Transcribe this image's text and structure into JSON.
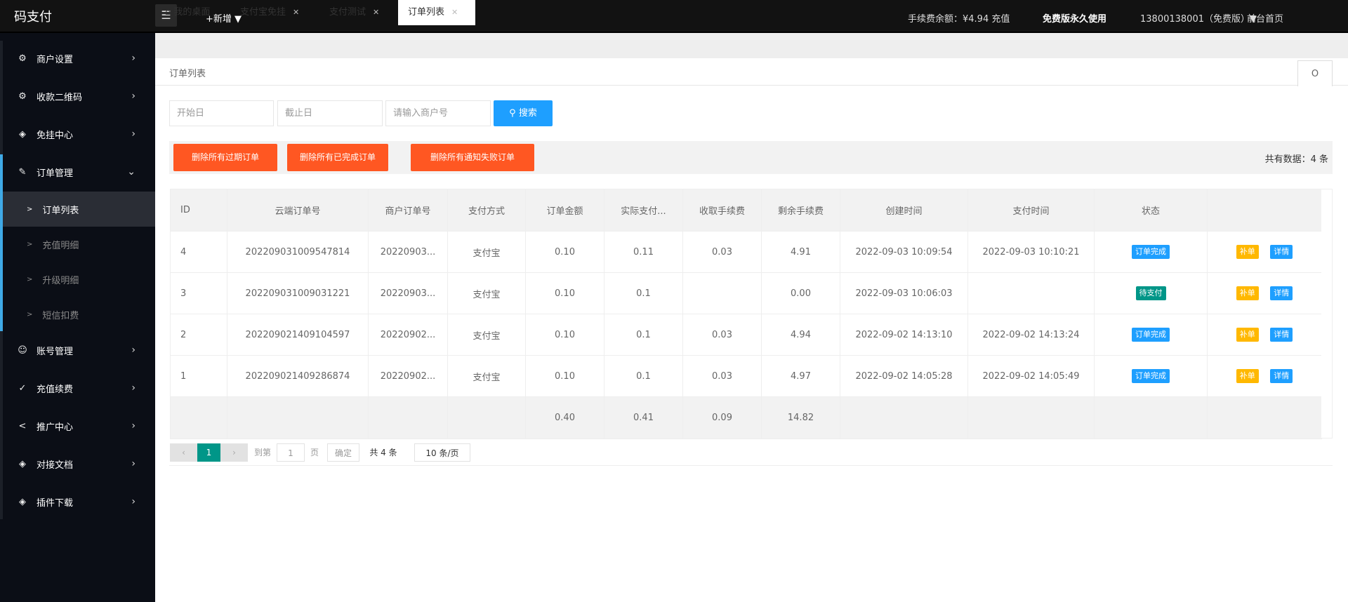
{
  "header": {
    "logo": "码支付",
    "menu_icon": "☰",
    "add_new": "+新增 ▼",
    "balance": "手续费余额：¥4.94 充值",
    "plan": "免费版永久使用",
    "account": "13800138001（免费版）▼",
    "frontpage": "前台首页"
  },
  "sidebar": {
    "items": [
      {
        "label": "商户设置",
        "icon": "⚙",
        "arrow": "›"
      },
      {
        "label": "收款二维码",
        "icon": "⚙",
        "arrow": "›"
      },
      {
        "label": "免挂中心",
        "icon": "◈",
        "arrow": "›"
      },
      {
        "label": "订单管理",
        "icon": "✎",
        "arrow": "⌄"
      },
      {
        "label": "账号管理",
        "icon": "☺",
        "arrow": "›"
      },
      {
        "label": "充值续费",
        "icon": "✓",
        "arrow": "›"
      },
      {
        "label": "推广中心",
        "icon": "<",
        "arrow": "›"
      },
      {
        "label": "对接文档",
        "icon": "◈",
        "arrow": "›"
      },
      {
        "label": "插件下载",
        "icon": "◈",
        "arrow": "›"
      }
    ],
    "sub_items": [
      {
        "label": "订单列表"
      },
      {
        "label": "充值明细"
      },
      {
        "label": "升级明细"
      },
      {
        "label": "短信扣费"
      }
    ]
  },
  "tabs": [
    {
      "label": "我的桌面",
      "icon": "⌂"
    },
    {
      "label": "支付宝免挂"
    },
    {
      "label": "支付测试"
    },
    {
      "label": "订单列表"
    }
  ],
  "breadcrumb": "订单列表",
  "refresh_icon": "O",
  "filters": {
    "start_placeholder": "开始日",
    "end_placeholder": "截止日",
    "merchant_placeholder": "请输入商户号",
    "search_label": "搜索"
  },
  "actions": {
    "delete_expired": "删除所有过期订单",
    "delete_completed": "删除所有已完成订单",
    "delete_notify_failed": "删除所有通知失败订单",
    "total": "共有数据：4 条"
  },
  "table": {
    "headers": [
      "ID",
      "云端订单号",
      "商户订单号",
      "支付方式",
      "订单金额",
      "实际支付...",
      "收取手续费",
      "剩余手续费",
      "创建时间",
      "支付时间",
      "状态",
      ""
    ],
    "rows": [
      {
        "id": "4",
        "cloud_no": "202209031009547814",
        "merchant_no": "20220903...",
        "method": "支付宝",
        "amount": "0.10",
        "paid": "0.11",
        "fee": "0.03",
        "remain": "4.91",
        "created": "2022-09-03 10:09:54",
        "paid_time": "2022-09-03 10:10:21",
        "status": "订单完成",
        "status_color": "#1e9fff",
        "btn1": "补单",
        "btn2": "详情"
      },
      {
        "id": "3",
        "cloud_no": "202209031009031221",
        "merchant_no": "20220903...",
        "method": "支付宝",
        "amount": "0.10",
        "paid": "0.1",
        "fee": "",
        "remain": "0.00",
        "created": "2022-09-03 10:06:03",
        "paid_time": "",
        "status": "待支付",
        "status_color": "#009688",
        "btn1": "补单",
        "btn2": "详情"
      },
      {
        "id": "2",
        "cloud_no": "202209021409104597",
        "merchant_no": "20220902...",
        "method": "支付宝",
        "amount": "0.10",
        "paid": "0.1",
        "fee": "0.03",
        "remain": "4.94",
        "created": "2022-09-02 14:13:10",
        "paid_time": "2022-09-02 14:13:24",
        "status": "订单完成",
        "status_color": "#1e9fff",
        "btn1": "补单",
        "btn2": "详情"
      },
      {
        "id": "1",
        "cloud_no": "202209021409286874",
        "merchant_no": "20220902...",
        "method": "支付宝",
        "amount": "0.10",
        "paid": "0.1",
        "fee": "0.03",
        "remain": "4.97",
        "created": "2022-09-02 14:05:28",
        "paid_time": "2022-09-02 14:05:49",
        "status": "订单完成",
        "status_color": "#1e9fff",
        "btn1": "补单",
        "btn2": "详情"
      }
    ],
    "totals": {
      "amount": "0.40",
      "paid": "0.41",
      "fee": "0.09",
      "remain": "14.82"
    }
  },
  "pager": {
    "prev": "‹",
    "current": "1",
    "next": "›",
    "goto": "到第",
    "page_value": "1",
    "page_unit": "页",
    "confirm": "确定",
    "total": "共 4 条",
    "per_page": "10 条/页"
  }
}
